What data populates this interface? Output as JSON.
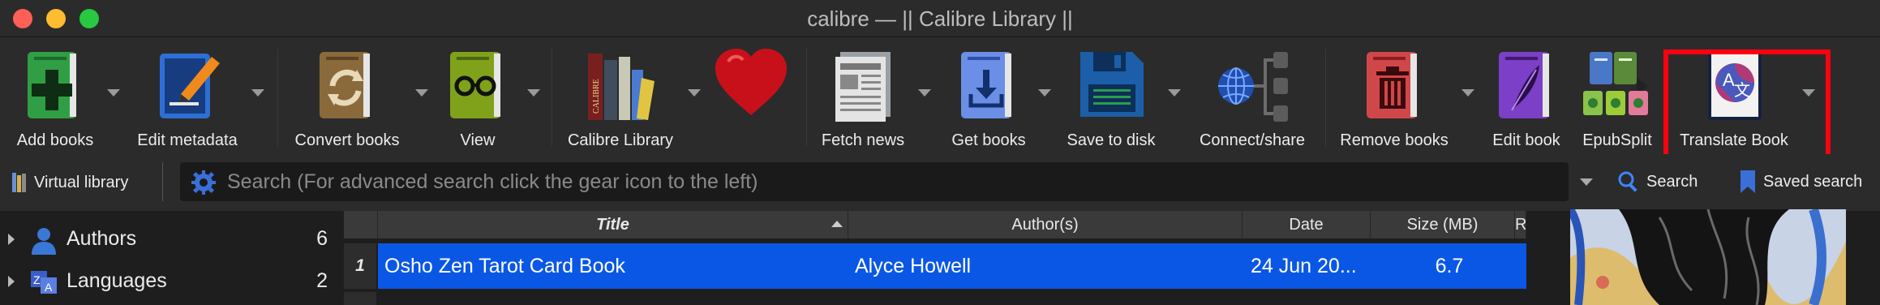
{
  "window": {
    "title": "calibre — || Calibre Library ||"
  },
  "toolbar": {
    "add_books": "Add books",
    "edit_metadata": "Edit metadata",
    "convert_books": "Convert books",
    "view": "View",
    "calibre_library": "Calibre Library",
    "fetch_news": "Fetch news",
    "get_books": "Get books",
    "save_to_disk": "Save to disk",
    "connect_share": "Connect/share",
    "remove_books": "Remove books",
    "edit_book": "Edit book",
    "epubsplit": "EpubSplit",
    "translate_book": "Translate Book"
  },
  "library_spine_text": "CALIBRE",
  "search": {
    "virtual_library": "Virtual library",
    "placeholder": "Search (For advanced search click the gear icon to the left)",
    "search_button": "Search",
    "saved_search_button": "Saved search"
  },
  "tag_browser": {
    "items": [
      {
        "label": "Authors",
        "count": "6",
        "icon": "person-icon"
      },
      {
        "label": "Languages",
        "count": "2",
        "icon": "language-icon"
      }
    ]
  },
  "table": {
    "columns": [
      "Title",
      "Author(s)",
      "Date",
      "Size (MB)",
      "Ra"
    ],
    "rows": [
      {
        "num": "1",
        "title": "Osho Zen Tarot Card Book",
        "author": "Alyce Howell",
        "date": "24 Jun 20...",
        "size": "6.7"
      }
    ]
  },
  "colors": {
    "selection": "#0a57e6",
    "highlight_box": "#ff0010",
    "accent": "#3a86ff"
  }
}
